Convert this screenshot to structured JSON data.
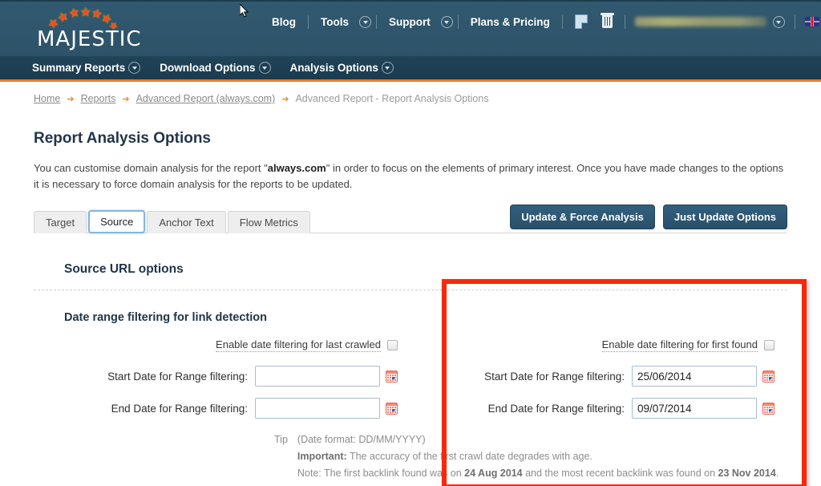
{
  "header": {
    "logo_text": "MAJESTIC",
    "logo_icon": "majestic-stars-arc-icon",
    "nav": [
      {
        "label": "Blog",
        "has_caret": false
      },
      {
        "label": "Tools",
        "has_caret": true
      },
      {
        "label": "Support",
        "has_caret": true
      },
      {
        "label": "Plans & Pricing",
        "has_caret": false
      }
    ],
    "doc_icon": "document-icon",
    "trash_icon": "trash-icon",
    "account_name": "",
    "account_caret": "chevron-down-icon",
    "flag_icon": "uk-flag-icon",
    "flag_caret": "chevron-down-icon"
  },
  "subnav": {
    "items": [
      {
        "label": "Summary Reports",
        "has_caret": true
      },
      {
        "label": "Download Options",
        "has_caret": true
      },
      {
        "label": "Analysis Options",
        "has_caret": true
      }
    ]
  },
  "breadcrumb": {
    "items": [
      {
        "label": "Home",
        "link": true
      },
      {
        "label": "Reports",
        "link": true
      },
      {
        "label": "Advanced Report (always.com)",
        "link": true
      },
      {
        "label": "Advanced Report - Report Analysis Options",
        "link": false
      }
    ],
    "separator": "➔"
  },
  "main": {
    "page_title": "Report Analysis Options",
    "intro_part1": "You can customise domain analysis for the report \"",
    "intro_domain": "always.com",
    "intro_part2": "\" in order to focus on the elements of primary interest. Once you have made changes to the options it is necessary to force domain analysis for the reports to be updated.",
    "tabs": [
      {
        "label": "Target",
        "active": false
      },
      {
        "label": "Source",
        "active": true
      },
      {
        "label": "Anchor Text",
        "active": false
      },
      {
        "label": "Flow Metrics",
        "active": false
      }
    ],
    "buttons": {
      "update_force": "Update & Force Analysis",
      "just_update": "Just Update Options"
    },
    "section_title": "Source URL options",
    "sub_title": "Date range filtering for link detection",
    "last_crawled": {
      "checkbox_label": "Enable date filtering for last crawled",
      "checked": false,
      "start_label": "Start Date for Range filtering:",
      "start_value": "",
      "start_placeholder": "",
      "end_label": "End Date for Range filtering:",
      "end_value": "",
      "end_placeholder": "",
      "calendar_icon": "calendar-icon"
    },
    "first_found": {
      "checkbox_label": "Enable date filtering for first found",
      "checked": false,
      "start_label": "Start Date for Range filtering:",
      "start_value": "25/06/2014",
      "start_placeholder": "",
      "end_label": "End Date for Range filtering:",
      "end_value": "09/07/2014",
      "end_placeholder": "",
      "calendar_icon": "calendar-icon"
    },
    "tip": {
      "word": "Tip",
      "line1": "(Date format: DD/MM/YYYY)",
      "line2_bold": "Important:",
      "line2_rest": " The accuracy of the first crawl date degrades with age.",
      "line3_pre": "Note: The first backlink found was on ",
      "line3_date1": "24 Aug 2014",
      "line3_mid": " and the most recent backlink was found on ",
      "line3_date2": "23 Nov 2014",
      "line3_post": "."
    }
  },
  "annotation": {
    "highlight_color": "#f6290b",
    "name": "red-highlight-box"
  },
  "colors": {
    "header_bg": "#2e5871",
    "subnav_bg": "#1e4056",
    "accent_orange": "#ef7c20",
    "button_blue": "#2c5572",
    "title_navy": "#21354a"
  }
}
